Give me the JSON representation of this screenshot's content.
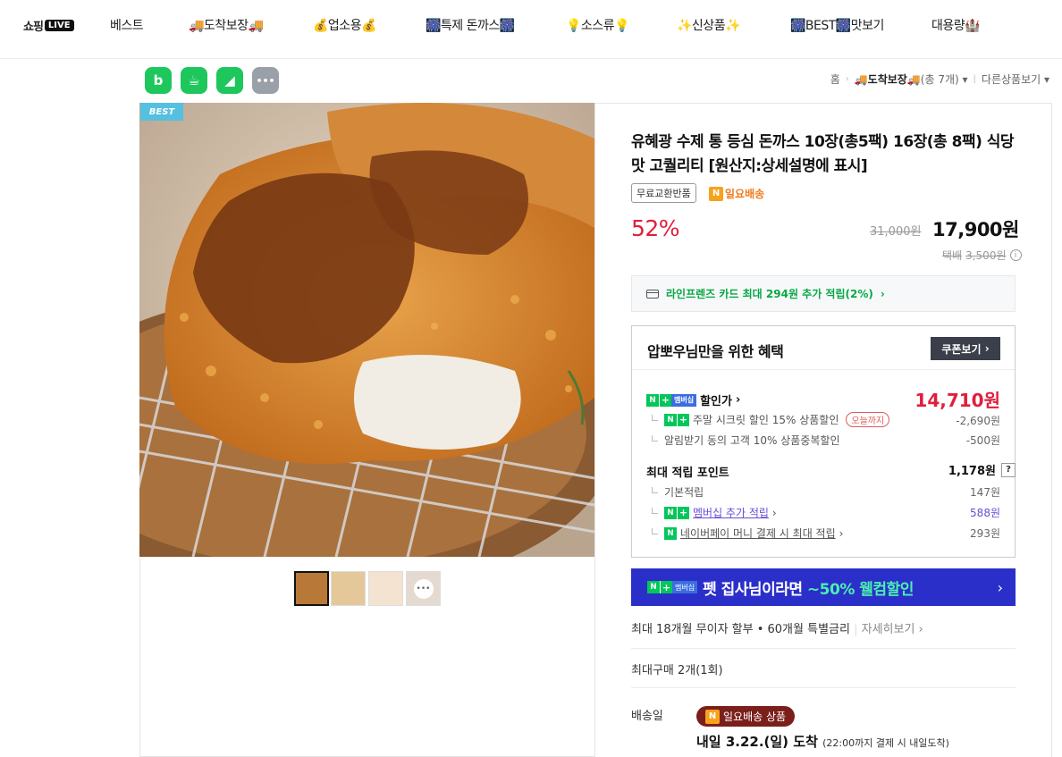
{
  "nav": {
    "logo_text": "쇼핑",
    "logo_badge": "LIVE",
    "items": [
      "베스트",
      "🚚도착보장🚚",
      "💰업소용💰",
      "🎆특제 돈까스🎆",
      "💡소스류💡",
      "✨신상품✨",
      "🎆BEST🎆맛보기",
      "대용량🏰"
    ]
  },
  "social": {
    "blog": "b",
    "cafe": "☕",
    "band": "◢",
    "more": "•••"
  },
  "breadcrumb": {
    "home": "홈",
    "category": "🚚도착보장🚚",
    "count": "(총 7개)",
    "other": "다른상품보기"
  },
  "badge_best": "BEST",
  "product": {
    "title": "유혜광 수제 통 등심 돈까스 10장(총5팩) 16장(총 8팩) 식당맛 고퀄리티 [원산지:상세설명에 표시]",
    "tag_exchange": "무료교환반품",
    "tag_delivery": "일요배송",
    "discount": "52%",
    "original_price": "31,000원",
    "price": "17,900원",
    "fee_label": "택배",
    "fee": "3,500원"
  },
  "card_promo": "라인프렌즈 카드 최대 294원 추가 적립(2%)",
  "benefit": {
    "title": "압뽀우님만을 위한 혜택",
    "coupon_btn": "쿠폰보기",
    "member_price_label": "할인가",
    "member_price": "14,710원",
    "weekend_label": "주말 시크릿 할인 15% 상품할인",
    "weekend_tag": "오늘까지",
    "weekend_val": "-2,690원",
    "alarm_label": "알림받기 동의 고객 10% 상품중복할인",
    "alarm_val": "-500원",
    "points_title": "최대 적립 포인트",
    "points_val": "1,178원",
    "basic_label": "기본적립",
    "basic_val": "147원",
    "member_label": "멤버십 추가 적립",
    "member_val": "588원",
    "pay_label": "네이버페이 머니 결제 시 최대 적립",
    "pay_val": "293원",
    "member_badge": "멤버십"
  },
  "pet": {
    "prefix": "펫 집사님이라면 ",
    "highlight": "~50% 웰컴할인",
    "badge": "멤버십"
  },
  "installment": {
    "text": "최대 18개월 무이자 할부 • 60개월 특별금리",
    "more": "자세히보기"
  },
  "max_buy": "최대구매 2개(1회)",
  "shipping": {
    "label": "배송일",
    "badge": "일요배송 상품",
    "date": "내일 3.22.(일) 도착",
    "note": "(22:00까지 결제 시 내일도착)"
  },
  "colors": {
    "accent_red": "#e01e3c",
    "naver_green": "#03c75a",
    "pet_banner": "#2b2fc9",
    "ship_badge": "#7a1f1a"
  }
}
